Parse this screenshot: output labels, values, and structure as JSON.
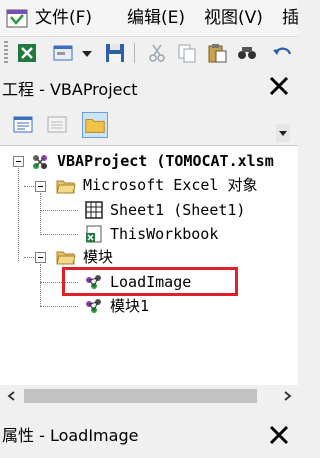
{
  "menubar": {
    "items": [
      {
        "label": "文件(F)"
      },
      {
        "label": "编辑(E)"
      },
      {
        "label": "视图(V)"
      },
      {
        "label": "插"
      }
    ]
  },
  "toolbar": {
    "buttons": [
      "excel-view-icon",
      "insert-userform-icon",
      "dropdown-arrow-icon",
      "save-icon",
      "cut-icon",
      "copy-icon",
      "paste-icon",
      "find-icon",
      "undo-icon"
    ]
  },
  "project_panel": {
    "title": "工程 - VBAProject",
    "buttons": [
      "view-code-icon",
      "view-object-icon",
      "toggle-folders-icon"
    ]
  },
  "tree": {
    "root": {
      "label": "VBAProject (TOMOCAT.xlsm"
    },
    "folders": [
      {
        "label": "Microsoft Excel 对象",
        "items": [
          {
            "label": "Sheet1 (Sheet1)"
          },
          {
            "label": "ThisWorkbook"
          }
        ]
      },
      {
        "label": "模块",
        "items": [
          {
            "label": "LoadImage"
          },
          {
            "label": "模块1"
          }
        ]
      }
    ]
  },
  "properties_panel": {
    "title": "属性 - LoadImage"
  },
  "colors": {
    "highlight": "#e0202a",
    "background": "#f0f0f0"
  }
}
